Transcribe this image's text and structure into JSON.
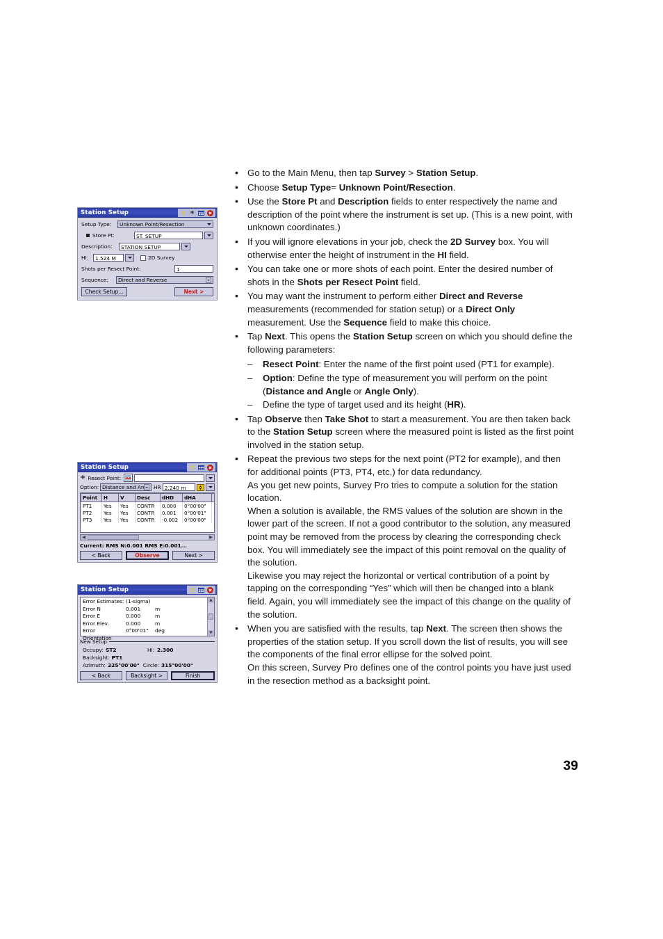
{
  "page": {
    "number": "39"
  },
  "colors": {
    "titlebar": "#2e3fa8",
    "dialog_bg": "#d6d6e4",
    "accent_red": "#d01a10",
    "field_white": "#ffffff"
  },
  "body_text": {
    "bullets": [
      {
        "id": "b1",
        "parts": [
          {
            "t": "Go to the Main Menu, then tap ",
            "b": false
          },
          {
            "t": "Survey",
            "b": true
          },
          {
            "t": " > ",
            "b": false
          },
          {
            "t": "Station Setup",
            "b": true
          },
          {
            "t": ".",
            "b": false
          }
        ]
      },
      {
        "id": "b2",
        "parts": [
          {
            "t": "Choose ",
            "b": false
          },
          {
            "t": "Setup Type",
            "b": true
          },
          {
            "t": "= ",
            "b": false
          },
          {
            "t": "Unknown Point/Resection",
            "b": true
          },
          {
            "t": ".",
            "b": false
          }
        ]
      },
      {
        "id": "b3",
        "parts": [
          {
            "t": "Use the ",
            "b": false
          },
          {
            "t": "Store Pt",
            "b": true
          },
          {
            "t": " and ",
            "b": false
          },
          {
            "t": "Description",
            "b": true
          },
          {
            "t": " fields to enter respectively the name and description of the point where the instrument is set up. (This is a new point, with unknown coordinates.)",
            "b": false
          }
        ]
      },
      {
        "id": "b4",
        "parts": [
          {
            "t": "If you will ignore elevations in your job, check the ",
            "b": false
          },
          {
            "t": "2D Survey",
            "b": true
          },
          {
            "t": " box. You will otherwise enter the height of instrument in the ",
            "b": false
          },
          {
            "t": "HI",
            "b": true
          },
          {
            "t": " field.",
            "b": false
          }
        ]
      },
      {
        "id": "b5",
        "parts": [
          {
            "t": "You can take one or more shots of each point. Enter the desired number of shots in the ",
            "b": false
          },
          {
            "t": "Shots per Resect Point",
            "b": true
          },
          {
            "t": " field.",
            "b": false
          }
        ]
      },
      {
        "id": "b6",
        "parts": [
          {
            "t": "You may want the instrument to perform either ",
            "b": false
          },
          {
            "t": "Direct and Reverse",
            "b": true
          },
          {
            "t": " measurements (recommended for station setup) or a ",
            "b": false
          },
          {
            "t": "Direct Only",
            "b": true
          },
          {
            "t": " measurement. Use the ",
            "b": false
          },
          {
            "t": "Sequence",
            "b": true
          },
          {
            "t": " field to make this choice.",
            "b": false
          }
        ]
      },
      {
        "id": "b7",
        "parts": [
          {
            "t": "Tap ",
            "b": false
          },
          {
            "t": "Next",
            "b": true
          },
          {
            "t": ". This opens the ",
            "b": false
          },
          {
            "t": "Station Setup",
            "b": true
          },
          {
            "t": " screen on which you should define the following parameters:",
            "b": false
          }
        ],
        "sub": [
          {
            "id": "s1",
            "parts": [
              {
                "t": "Resect Point",
                "b": true
              },
              {
                "t": ": Enter the name of the first point used (PT1 for example).",
                "b": false
              }
            ]
          },
          {
            "id": "s2",
            "parts": [
              {
                "t": "Option",
                "b": true
              },
              {
                "t": ": Define the type of measurement you will perform on the point (",
                "b": false
              },
              {
                "t": "Distance and Angle",
                "b": true
              },
              {
                "t": " or ",
                "b": false
              },
              {
                "t": "Angle Only",
                "b": true
              },
              {
                "t": ").",
                "b": false
              }
            ]
          },
          {
            "id": "s3",
            "parts": [
              {
                "t": "Define the type of target used and its height (",
                "b": false
              },
              {
                "t": "HR",
                "b": true
              },
              {
                "t": ").",
                "b": false
              }
            ]
          }
        ]
      },
      {
        "id": "b8",
        "parts": [
          {
            "t": "Tap ",
            "b": false
          },
          {
            "t": "Observe",
            "b": true
          },
          {
            "t": " then ",
            "b": false
          },
          {
            "t": "Take Shot",
            "b": true
          },
          {
            "t": " to start a measurement. You are then taken back to the ",
            "b": false
          },
          {
            "t": "Station Setup",
            "b": true
          },
          {
            "t": " screen where the measured point is listed as the first point involved in the station setup.",
            "b": false
          }
        ]
      },
      {
        "id": "b9",
        "parts": [
          {
            "t": "Repeat the previous two steps for the next point (PT2 for example), and then for additional points (PT3, PT4, etc.) for data redundancy.",
            "b": false
          }
        ],
        "paras": [
          "As you get new points, Survey Pro tries to compute a solution for the station location.",
          "When a solution is available, the RMS values of the solution are shown in the lower part of the screen. If not a good contributor to the solution, any measured point may be removed from the process by clearing the corresponding check box. You will immediately see the impact of this point removal on the quality of the solution.",
          "Likewise you may reject the horizontal or vertical contribution of a point by tapping on the corresponding “Yes” which will then be changed into a blank field. Again, you will immediately see the impact of this change on the quality of the solution."
        ]
      },
      {
        "id": "b10",
        "parts": [
          {
            "t": "When you are satisfied with the results, tap ",
            "b": false
          },
          {
            "t": "Next",
            "b": true
          },
          {
            "t": ". The screen then shows the properties of the station setup. If you scroll down the list of results, you will see the components of the final error ellipse for the solved point.",
            "b": false
          }
        ],
        "paras": [
          "On this screen, Survey Pro defines one of the control points you have just used in the resection method as a backsight point."
        ]
      }
    ]
  },
  "screenshot1": {
    "title": "Station Setup",
    "titlebar_icons": [
      "help-icon",
      "star-icon",
      "grid-icon",
      "close-icon"
    ],
    "fields": {
      "setup_type_label": "Setup Type:",
      "setup_type_value": "Unknown Point/Resection",
      "store_pt_label": "Store Pt:",
      "store_pt_value": "ST_SETUP",
      "description_label": "Description:",
      "description_value": "STATION SETUP",
      "hi_label": "HI:",
      "hi_value": "1.524 M",
      "survey2d_label": "2D Survey",
      "survey2d_checked": false,
      "shots_label": "Shots per Resect Point:",
      "shots_value": "1",
      "sequence_label": "Sequence:",
      "sequence_value": "Direct and Reverse"
    },
    "buttons": {
      "check_setup": "Check Setup...",
      "next": "Next >"
    }
  },
  "screenshot2": {
    "title": "Station Setup",
    "titlebar_icons": [
      "help-icon",
      "grid-icon",
      "close-icon"
    ],
    "fields": {
      "resect_point_label": "Resect Point:",
      "resect_point_value": "",
      "option_label": "Option:",
      "option_value": "Distance and Angle",
      "hr_label": "HR",
      "hr_value": "2.240 m"
    },
    "table": {
      "columns": [
        "Point",
        "H",
        "V",
        "Desc",
        "dHD",
        "dHA"
      ],
      "rows": [
        [
          "PT1",
          "Yes",
          "Yes",
          "CONTR",
          "0.000",
          "0°00'00\""
        ],
        [
          "PT2",
          "Yes",
          "Yes",
          "CONTR",
          "0.001",
          "0°00'01\""
        ],
        [
          "PT3",
          "Yes",
          "Yes",
          "CONTR",
          "-0.002",
          "0°00'00\""
        ]
      ]
    },
    "status": "Current: RMS N:0.001 RMS E:0.001...",
    "buttons": {
      "back": "< Back",
      "observe": "Observe",
      "next": "Next >"
    }
  },
  "screenshot3": {
    "title": "Station Setup",
    "titlebar_icons": [
      "help-icon",
      "grid-icon",
      "close-icon"
    ],
    "results": [
      {
        "label": "Error Estimates:",
        "value": "(1-sigma)",
        "unit": ""
      },
      {
        "label": "Error N",
        "value": "0.001",
        "unit": "m"
      },
      {
        "label": "Error E",
        "value": "0.000",
        "unit": "m"
      },
      {
        "label": "Error Elev.",
        "value": "0.000",
        "unit": "m"
      },
      {
        "label": "Error Orientation",
        "value": "0°00'01\"",
        "unit": "deg"
      }
    ],
    "group_title": "New Setup",
    "summary": {
      "occupy_label": "Occupy:",
      "occupy_value": "ST2",
      "hi_label": "HI:",
      "hi_value": "2.300",
      "backsight_label": "Backsight:",
      "backsight_value": "PT1",
      "azimuth_label": "Azimuth:",
      "azimuth_value": "225°00'00\"",
      "circle_label": "Circle:",
      "circle_value": "315°00'00\""
    },
    "buttons": {
      "back": "< Back",
      "backsight": "Backsight >",
      "finish": "Finish"
    }
  }
}
